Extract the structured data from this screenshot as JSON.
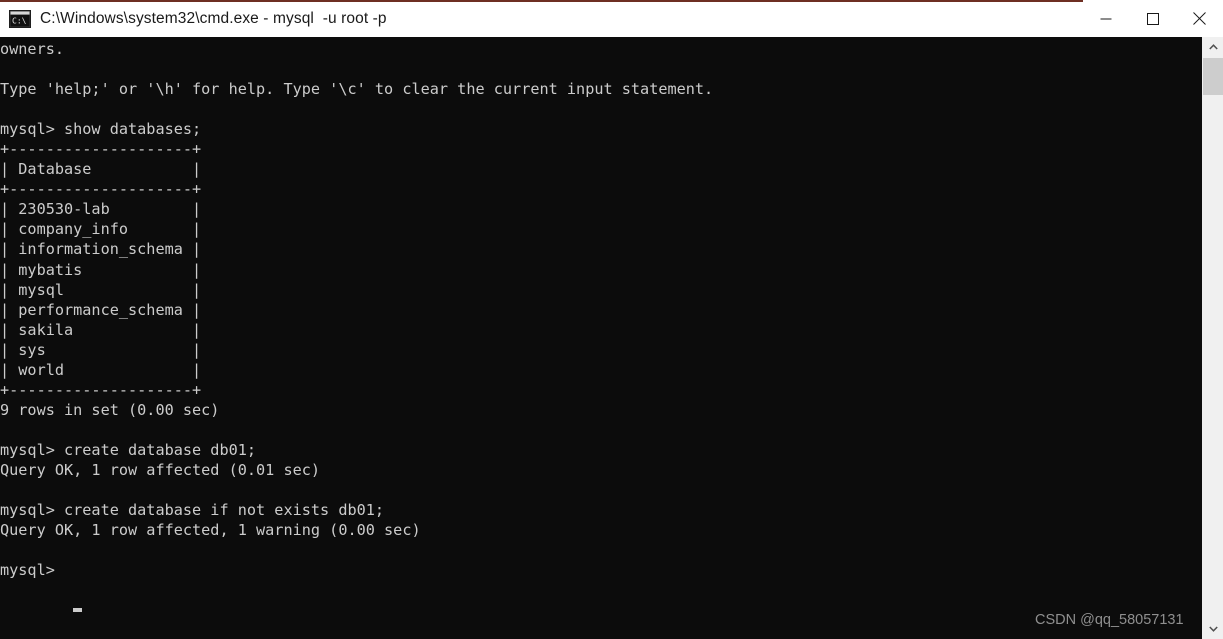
{
  "window": {
    "title": "C:\\Windows\\system32\\cmd.exe - mysql  -u root -p",
    "icon": "cmd-icon",
    "background_color": "#0c0c0c",
    "titlebar_color": "#ffffff",
    "text_color": "#cccccc"
  },
  "window_controls": {
    "minimize_label": "Minimize",
    "maximize_label": "Maximize",
    "close_label": "Close"
  },
  "terminal": {
    "content": "owners.\n\nType 'help;' or '\\h' for help. Type '\\c' to clear the current input statement.\n\nmysql> show databases;\n+--------------------+\n| Database           |\n+--------------------+\n| 230530-lab         |\n| company_info       |\n| information_schema |\n| mybatis            |\n| mysql              |\n| performance_schema |\n| sakila             |\n| sys                |\n| world              |\n+--------------------+\n9 rows in set (0.00 sec)\n\nmysql> create database db01;\nQuery OK, 1 row affected (0.01 sec)\n\nmysql> create database if not exists db01;\nQuery OK, 1 row affected, 1 warning (0.00 sec)\n\nmysql> ",
    "prompt": "mysql>",
    "cursor": "_",
    "lines": [
      "owners.",
      "",
      "Type 'help;' or '\\h' for help. Type '\\c' to clear the current input statement.",
      "",
      "mysql> show databases;",
      "+--------------------+",
      "| Database           |",
      "+--------------------+",
      "| 230530-lab         |",
      "| company_info       |",
      "| information_schema |",
      "| mybatis            |",
      "| mysql              |",
      "| performance_schema |",
      "| sakila             |",
      "| sys                |",
      "| world              |",
      "+--------------------+",
      "9 rows in set (0.00 sec)",
      "",
      "mysql> create database db01;",
      "Query OK, 1 row affected (0.01 sec)",
      "",
      "mysql> create database if not exists db01;",
      "Query OK, 1 row affected, 1 warning (0.00 sec)",
      "",
      "mysql> "
    ],
    "databases": [
      "230530-lab",
      "company_info",
      "information_schema",
      "mybatis",
      "mysql",
      "performance_schema",
      "sakila",
      "sys",
      "world"
    ],
    "table_header": "Database",
    "result_summary": "9 rows in set (0.00 sec)",
    "commands": [
      "show databases;",
      "create database db01;",
      "create database if not exists db01;"
    ],
    "query_results": [
      "Query OK, 1 row affected (0.01 sec)",
      "Query OK, 1 row affected, 1 warning (0.00 sec)"
    ]
  },
  "watermark": {
    "text": "CSDN @qq_58057131"
  },
  "scrollbar": {
    "up_arrow": "chevron-up-icon",
    "down_arrow": "chevron-down-icon"
  }
}
